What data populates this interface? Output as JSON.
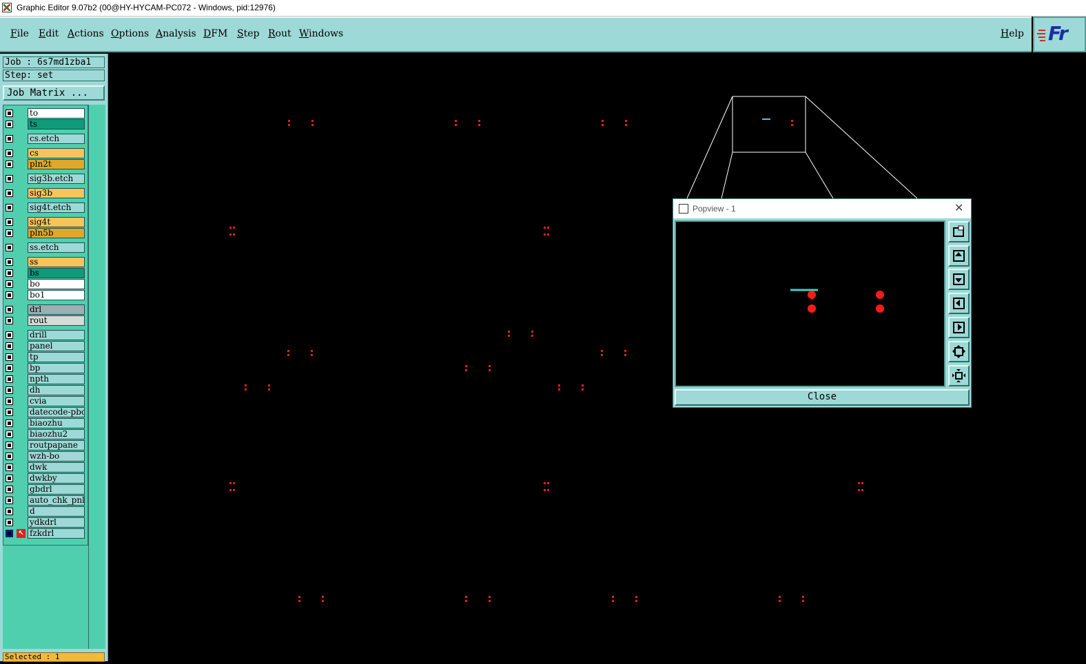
{
  "window": {
    "title": "Graphic Editor 9.07b2 (00@HY-HYCAM-PC072 - Windows, pid:12976)"
  },
  "menu": {
    "items": [
      "File",
      "Edit",
      "Actions",
      "Options",
      "Analysis",
      "DFM",
      "Step",
      "Rout",
      "Windows"
    ],
    "help": "Help",
    "logo_text": "Fr"
  },
  "job": {
    "job_label": "Job : 6s7md1zba1",
    "step_label": "Step: set",
    "matrix_button": "Job Matrix ..."
  },
  "layers": [
    {
      "name": "to",
      "color": "#ffffff"
    },
    {
      "name": "ts",
      "color": "#0f9a7a"
    },
    {
      "name": "cs.etch",
      "color": "#9dd9d6"
    },
    {
      "name": "cs",
      "color": "#f7c35a"
    },
    {
      "name": "pln2t",
      "color": "#e0a82a"
    },
    {
      "name": "sig3b.etch",
      "color": "#9dd9d6"
    },
    {
      "name": "sig3b",
      "color": "#f7c35a"
    },
    {
      "name": "sig4t.etch",
      "color": "#9dd9d6"
    },
    {
      "name": "sig4t",
      "color": "#f7c35a"
    },
    {
      "name": "pln5b",
      "color": "#e0a82a"
    },
    {
      "name": "ss.etch",
      "color": "#9dd9d6"
    },
    {
      "name": "ss",
      "color": "#f7c35a"
    },
    {
      "name": "bs",
      "color": "#0f9a7a"
    },
    {
      "name": "bo",
      "color": "#ffffff"
    },
    {
      "name": "bo1",
      "color": "#ffffff"
    },
    {
      "name": "drl",
      "color": "#9ab0b3"
    },
    {
      "name": "rout",
      "color": "#d9d9d9"
    },
    {
      "name": "drill",
      "color": "#9dd9d6"
    },
    {
      "name": "panel",
      "color": "#9dd9d6"
    },
    {
      "name": "tp",
      "color": "#9dd9d6"
    },
    {
      "name": "bp",
      "color": "#9dd9d6"
    },
    {
      "name": "npth",
      "color": "#9dd9d6"
    },
    {
      "name": "dh",
      "color": "#9dd9d6"
    },
    {
      "name": "cvia",
      "color": "#9dd9d6"
    },
    {
      "name": "datecode-pbo",
      "color": "#9dd9d6"
    },
    {
      "name": "biaozhu",
      "color": "#9dd9d6"
    },
    {
      "name": "biaozhu2",
      "color": "#9dd9d6"
    },
    {
      "name": "routpapane",
      "color": "#9dd9d6"
    },
    {
      "name": "wzh-bo",
      "color": "#9dd9d6"
    },
    {
      "name": "dwk",
      "color": "#9dd9d6"
    },
    {
      "name": "dwkby",
      "color": "#9dd9d6"
    },
    {
      "name": "gbdrl",
      "color": "#9dd9d6"
    },
    {
      "name": "auto_chk_pnl",
      "color": "#9dd9d6"
    },
    {
      "name": "d",
      "color": "#9dd9d6"
    },
    {
      "name": "ydkdrl",
      "color": "#9dd9d6"
    },
    {
      "name": "fzkdrl",
      "color": "#9dd9d6",
      "active": true
    }
  ],
  "status": {
    "selected": "Selected : 1"
  },
  "popview": {
    "title": "Popview - 1",
    "close_button": "Close",
    "tools": [
      "zoom-fit-icon",
      "pan-up-icon",
      "pan-down-icon",
      "pan-left-icon",
      "pan-right-icon",
      "zoom-in-icon",
      "zoom-out-icon"
    ]
  },
  "colors": {
    "panel": "#9dd9d6",
    "layer_area": "#4fcfae",
    "feature": "#e02020",
    "highlight": "#3fd0d0"
  }
}
